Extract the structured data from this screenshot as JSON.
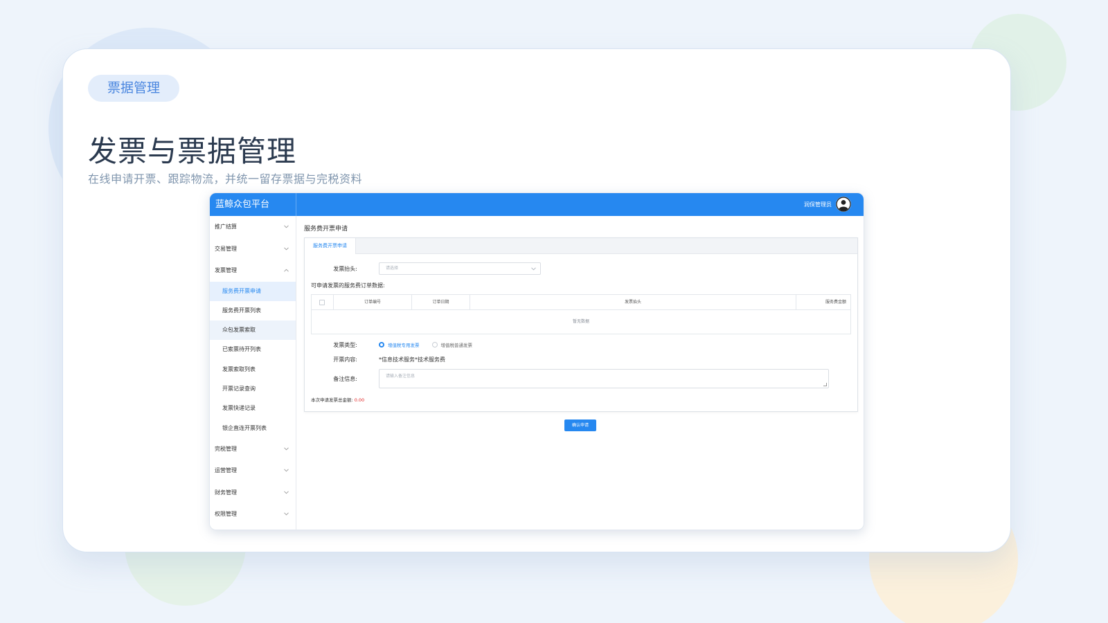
{
  "slide": {
    "tag": "票据管理",
    "title": "发票与票据管理",
    "subtitle": "在线申请开票、跟踪物流，并统一留存票据与完税资料"
  },
  "app": {
    "brand": "蓝鲸众包平台",
    "user_name": "润保管理员",
    "sidebar": {
      "groups_before": [
        {
          "label": "推广结算"
        },
        {
          "label": "交易管理"
        }
      ],
      "open_group": {
        "label": "发票管理"
      },
      "sub_items": [
        {
          "label": "服务费开票申请"
        },
        {
          "label": "服务费开票列表"
        },
        {
          "label": "众包发票索取"
        },
        {
          "label": "已索票待开列表"
        },
        {
          "label": "发票索取列表"
        },
        {
          "label": "开票记录查询"
        },
        {
          "label": "发票快递记录"
        },
        {
          "label": "银企直连开票列表"
        }
      ],
      "groups_after": [
        {
          "label": "完税管理"
        },
        {
          "label": "运营管理"
        },
        {
          "label": "财务管理"
        },
        {
          "label": "权限管理"
        }
      ]
    },
    "main": {
      "page_title": "服务费开票申请",
      "tab_label": "服务费开票申请",
      "invoice_header_label": "发票抬头:",
      "invoice_header_placeholder": "请选择",
      "section_title": "可申请发票的服务费订单数据:",
      "table": {
        "columns": [
          "订单编号",
          "订单日期",
          "发票抬头",
          "服务费金额"
        ],
        "empty_text": "暂无数据"
      },
      "invoice_type_label": "发票类型:",
      "invoice_types": [
        {
          "label": "增值税专用发票",
          "checked": true
        },
        {
          "label": "增值税普通发票",
          "checked": false
        }
      ],
      "content_label": "开票内容:",
      "content_value": "*信息技术服务*技术服务费",
      "remark_label": "备注信息:",
      "remark_placeholder": "请输入备注信息",
      "total_label": "本次申请发票总金额:",
      "total_amount": "0.00",
      "submit_label": "确认申请"
    }
  },
  "colors": {
    "primary": "#2688f0",
    "accent_text": "#4a86df",
    "amount": "#e02424"
  },
  "icons": [
    "user-avatar-icon",
    "chevron-down-icon",
    "chevron-up-icon",
    "resize-grip-icon"
  ]
}
